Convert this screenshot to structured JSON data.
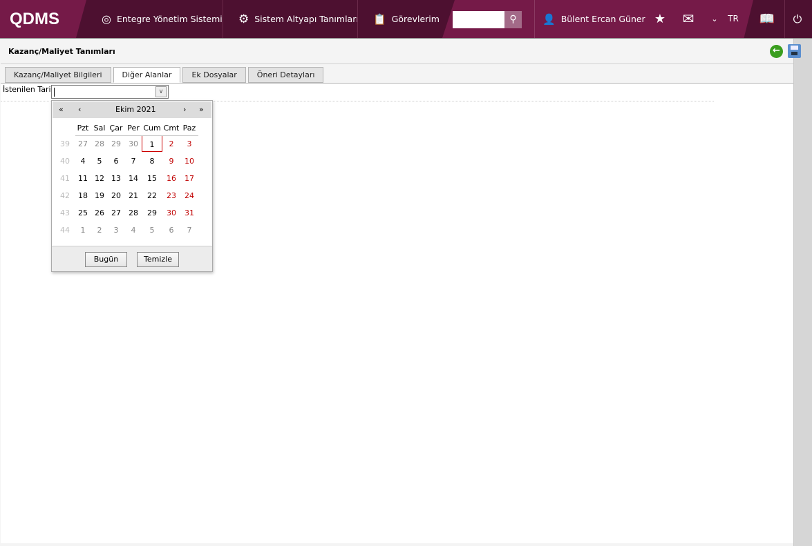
{
  "topbar": {
    "logo": "QDMS",
    "nav": [
      "Entegre Yönetim Sistemi",
      "Sistem Altyapı Tanımları",
      "Görevlerim"
    ],
    "search_value": "",
    "user": "Bülent Ercan Güner",
    "language": "TR",
    "accent": "#751a48",
    "dark": "#4d1030"
  },
  "page": {
    "title": "Kazanç/Maliyet Tanımları",
    "tabs": [
      "Kazanç/Maliyet Bilgileri",
      "Diğer Alanlar",
      "Ek Dosyalar",
      "Öneri Detayları"
    ],
    "active_tab": 1
  },
  "form": {
    "field_label": "İstenilen Tarih",
    "field_value": ""
  },
  "calendar": {
    "month_label": "Ekim 2021",
    "prev_year": "«",
    "prev_month": "‹",
    "next_month": "›",
    "next_year": "»",
    "weekdays": [
      "Pzt",
      "Sal",
      "Çar",
      "Per",
      "Cum",
      "Cmt",
      "Paz"
    ],
    "weeks": [
      {
        "week": "39",
        "days": [
          "27",
          "28",
          "29",
          "30",
          "1",
          "2",
          "3"
        ],
        "other": [
          1,
          1,
          1,
          1,
          0,
          0,
          0
        ]
      },
      {
        "week": "40",
        "days": [
          "4",
          "5",
          "6",
          "7",
          "8",
          "9",
          "10"
        ],
        "other": [
          0,
          0,
          0,
          0,
          0,
          0,
          0
        ]
      },
      {
        "week": "41",
        "days": [
          "11",
          "12",
          "13",
          "14",
          "15",
          "16",
          "17"
        ],
        "other": [
          0,
          0,
          0,
          0,
          0,
          0,
          0
        ]
      },
      {
        "week": "42",
        "days": [
          "18",
          "19",
          "20",
          "21",
          "22",
          "23",
          "24"
        ],
        "other": [
          0,
          0,
          0,
          0,
          0,
          0,
          0
        ]
      },
      {
        "week": "43",
        "days": [
          "25",
          "26",
          "27",
          "28",
          "29",
          "30",
          "31"
        ],
        "other": [
          0,
          0,
          0,
          0,
          0,
          0,
          0
        ]
      },
      {
        "week": "44",
        "days": [
          "1",
          "2",
          "3",
          "4",
          "5",
          "6",
          "7"
        ],
        "other": [
          1,
          1,
          1,
          1,
          1,
          1,
          1
        ]
      }
    ],
    "selected": "1",
    "today_label": "Bugün",
    "clear_label": "Temizle",
    "weekend_color": "#c00000"
  }
}
